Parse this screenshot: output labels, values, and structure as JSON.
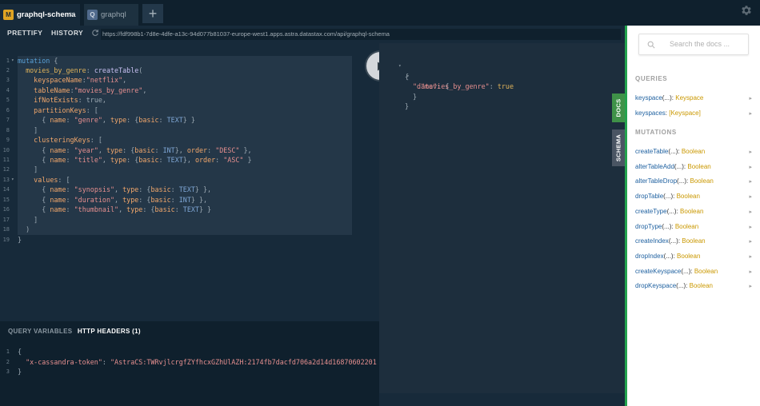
{
  "tabs": [
    {
      "badge": "M",
      "label": "graphql-schema",
      "close": "×"
    },
    {
      "badge": "Q",
      "label": "graphql"
    }
  ],
  "add_tab_label": "+",
  "toolbar": {
    "prettify_label": "PRETTIFY",
    "history_label": "HISTORY",
    "url": "https://fdf998b1-7d8e-4dfe-a13c-94d077b81037-europe-west1.apps.astra.datastax.com/api/graphql-schema"
  },
  "editor": {
    "line_numbers": [
      "1",
      "2",
      "3",
      "4",
      "5",
      "6",
      "7",
      "8",
      "9",
      "10",
      "11",
      "12",
      "13",
      "14",
      "15",
      "16",
      "17",
      "18",
      "19"
    ],
    "lines": [
      [
        {
          "t": "mutation",
          "c": "kw"
        },
        {
          "t": " {",
          "c": "def"
        }
      ],
      [
        {
          "t": "  movies_by_genre",
          "c": "prop"
        },
        {
          "t": ": ",
          "c": "def"
        },
        {
          "t": "createTable",
          "c": "fn"
        },
        {
          "t": "(",
          "c": "def"
        }
      ],
      [
        {
          "t": "    keyspaceName",
          "c": "arg"
        },
        {
          "t": ":",
          "c": "def"
        },
        {
          "t": "\"netflix\"",
          "c": "str"
        },
        {
          "t": ",",
          "c": "def"
        }
      ],
      [
        {
          "t": "    tableName",
          "c": "arg"
        },
        {
          "t": ":",
          "c": "def"
        },
        {
          "t": "\"movies_by_genre\"",
          "c": "str"
        },
        {
          "t": ",",
          "c": "def"
        }
      ],
      [
        {
          "t": "    ifNotExists",
          "c": "arg"
        },
        {
          "t": ": ",
          "c": "def"
        },
        {
          "t": "true",
          "c": "def"
        },
        {
          "t": ",",
          "c": "def"
        }
      ],
      [
        {
          "t": "    partitionKeys",
          "c": "arg"
        },
        {
          "t": ": [",
          "c": "def"
        }
      ],
      [
        {
          "t": "      { ",
          "c": "def"
        },
        {
          "t": "name",
          "c": "arg"
        },
        {
          "t": ": ",
          "c": "def"
        },
        {
          "t": "\"genre\"",
          "c": "str"
        },
        {
          "t": ", ",
          "c": "def"
        },
        {
          "t": "type",
          "c": "arg"
        },
        {
          "t": ": {",
          "c": "def"
        },
        {
          "t": "basic",
          "c": "arg"
        },
        {
          "t": ": ",
          "c": "def"
        },
        {
          "t": "TEXT",
          "c": "enum"
        },
        {
          "t": "} }",
          "c": "def"
        }
      ],
      [
        {
          "t": "    ]",
          "c": "def"
        }
      ],
      [
        {
          "t": "    clusteringKeys",
          "c": "arg"
        },
        {
          "t": ": [",
          "c": "def"
        }
      ],
      [
        {
          "t": "      { ",
          "c": "def"
        },
        {
          "t": "name",
          "c": "arg"
        },
        {
          "t": ": ",
          "c": "def"
        },
        {
          "t": "\"year\"",
          "c": "str"
        },
        {
          "t": ", ",
          "c": "def"
        },
        {
          "t": "type",
          "c": "arg"
        },
        {
          "t": ": {",
          "c": "def"
        },
        {
          "t": "basic",
          "c": "arg"
        },
        {
          "t": ": ",
          "c": "def"
        },
        {
          "t": "INT",
          "c": "enum"
        },
        {
          "t": "}, ",
          "c": "def"
        },
        {
          "t": "order",
          "c": "arg"
        },
        {
          "t": ": ",
          "c": "def"
        },
        {
          "t": "\"DESC\"",
          "c": "str"
        },
        {
          "t": " },",
          "c": "def"
        }
      ],
      [
        {
          "t": "      { ",
          "c": "def"
        },
        {
          "t": "name",
          "c": "arg"
        },
        {
          "t": ": ",
          "c": "def"
        },
        {
          "t": "\"title\"",
          "c": "str"
        },
        {
          "t": ", ",
          "c": "def"
        },
        {
          "t": "type",
          "c": "arg"
        },
        {
          "t": ": {",
          "c": "def"
        },
        {
          "t": "basic",
          "c": "arg"
        },
        {
          "t": ": ",
          "c": "def"
        },
        {
          "t": "TEXT",
          "c": "enum"
        },
        {
          "t": "}, ",
          "c": "def"
        },
        {
          "t": "order",
          "c": "arg"
        },
        {
          "t": ": ",
          "c": "def"
        },
        {
          "t": "\"ASC\"",
          "c": "str"
        },
        {
          "t": " }",
          "c": "def"
        }
      ],
      [
        {
          "t": "    ]",
          "c": "def"
        }
      ],
      [
        {
          "t": "    values",
          "c": "arg"
        },
        {
          "t": ": [",
          "c": "def"
        }
      ],
      [
        {
          "t": "      { ",
          "c": "def"
        },
        {
          "t": "name",
          "c": "arg"
        },
        {
          "t": ": ",
          "c": "def"
        },
        {
          "t": "\"synopsis\"",
          "c": "str"
        },
        {
          "t": ", ",
          "c": "def"
        },
        {
          "t": "type",
          "c": "arg"
        },
        {
          "t": ": {",
          "c": "def"
        },
        {
          "t": "basic",
          "c": "arg"
        },
        {
          "t": ": ",
          "c": "def"
        },
        {
          "t": "TEXT",
          "c": "enum"
        },
        {
          "t": "} },",
          "c": "def"
        }
      ],
      [
        {
          "t": "      { ",
          "c": "def"
        },
        {
          "t": "name",
          "c": "arg"
        },
        {
          "t": ": ",
          "c": "def"
        },
        {
          "t": "\"duration\"",
          "c": "str"
        },
        {
          "t": ", ",
          "c": "def"
        },
        {
          "t": "type",
          "c": "arg"
        },
        {
          "t": ": {",
          "c": "def"
        },
        {
          "t": "basic",
          "c": "arg"
        },
        {
          "t": ": ",
          "c": "def"
        },
        {
          "t": "INT",
          "c": "enum"
        },
        {
          "t": "} },",
          "c": "def"
        }
      ],
      [
        {
          "t": "      { ",
          "c": "def"
        },
        {
          "t": "name",
          "c": "arg"
        },
        {
          "t": ": ",
          "c": "def"
        },
        {
          "t": "\"thumbnail\"",
          "c": "str"
        },
        {
          "t": ", ",
          "c": "def"
        },
        {
          "t": "type",
          "c": "arg"
        },
        {
          "t": ": {",
          "c": "def"
        },
        {
          "t": "basic",
          "c": "arg"
        },
        {
          "t": ": ",
          "c": "def"
        },
        {
          "t": "TEXT",
          "c": "enum"
        },
        {
          "t": "} }",
          "c": "def"
        }
      ],
      [
        {
          "t": "    ]",
          "c": "def"
        }
      ],
      [
        {
          "t": "  )",
          "c": "def"
        }
      ],
      [
        {
          "t": "}",
          "c": "def"
        }
      ]
    ]
  },
  "variables": {
    "tab_query_variables": "QUERY VARIABLES",
    "tab_http_headers": "HTTP HEADERS (1)",
    "line_numbers": [
      "1",
      "2",
      "3"
    ],
    "lines": [
      [
        {
          "t": "{",
          "c": "def"
        }
      ],
      [
        {
          "t": "  \"x-cassandra-token\"",
          "c": "str"
        },
        {
          "t": ": ",
          "c": "def"
        },
        {
          "t": "\"AstraCS:TWRvjlcrgfZYfhcxGZhUlAZH:2174fb7dacfd706a2d14d16870602201",
          "c": "str"
        }
      ],
      [
        {
          "t": "}",
          "c": "def"
        }
      ]
    ]
  },
  "result": {
    "open_brace": "{",
    "data_key": "\"data\"",
    "data_open": ": {",
    "field_key": "\"movies_by_genre\"",
    "field_value": "true",
    "inner_close": "}",
    "outer_close": "}"
  },
  "side_tabs": {
    "docs": "DOCS",
    "schema": "SCHEMA"
  },
  "docs": {
    "search_placeholder": "Search the docs ...",
    "queries_title": "QUERIES",
    "queries": [
      {
        "name": "keyspace",
        "args": "(...)",
        "colon": ": ",
        "type": "Keyspace"
      },
      {
        "name": "keyspaces",
        "args": "",
        "colon": ": ",
        "type": "[Keyspace]"
      }
    ],
    "mutations_title": "MUTATIONS",
    "mutations": [
      {
        "name": "createTable",
        "args": "(...)",
        "colon": ": ",
        "type": "Boolean"
      },
      {
        "name": "alterTableAdd",
        "args": "(...)",
        "colon": ": ",
        "type": "Boolean"
      },
      {
        "name": "alterTableDrop",
        "args": "(...)",
        "colon": ": ",
        "type": "Boolean"
      },
      {
        "name": "dropTable",
        "args": "(...)",
        "colon": ": ",
        "type": "Boolean"
      },
      {
        "name": "createType",
        "args": "(...)",
        "colon": ": ",
        "type": "Boolean"
      },
      {
        "name": "dropType",
        "args": "(...)",
        "colon": ": ",
        "type": "Boolean"
      },
      {
        "name": "createIndex",
        "args": "(...)",
        "colon": ": ",
        "type": "Boolean"
      },
      {
        "name": "dropIndex",
        "args": "(...)",
        "colon": ": ",
        "type": "Boolean"
      },
      {
        "name": "createKeyspace",
        "args": "(...)",
        "colon": ": ",
        "type": "Boolean"
      },
      {
        "name": "dropKeyspace",
        "args": "(...)",
        "colon": ": ",
        "type": "Boolean"
      }
    ],
    "chevron": "▸"
  },
  "colors": {
    "accent_green": "#23a24d",
    "docs_tab": "#3f9248",
    "schema_tab": "#4a5563",
    "doc_field": "#1f61a0",
    "doc_type": "#ca9800"
  },
  "icons": [
    "gear-icon",
    "reload-icon",
    "play-icon",
    "search-icon",
    "close-icon",
    "plus-icon",
    "fold-arrow-icon",
    "chevron-right-icon"
  ]
}
